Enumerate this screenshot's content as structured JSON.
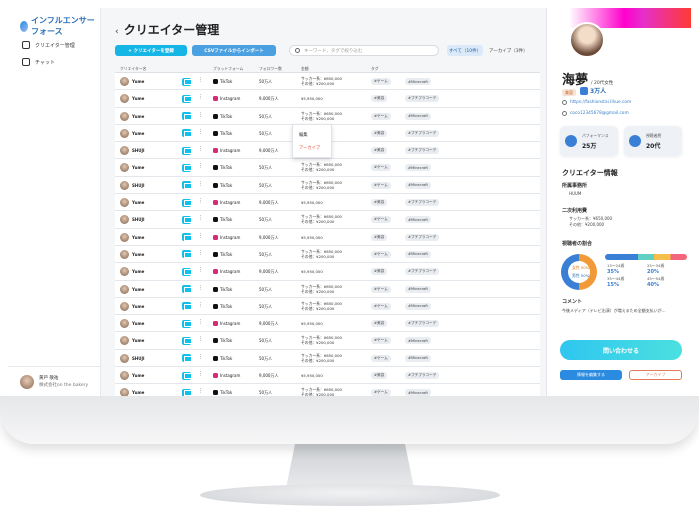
{
  "app": {
    "logo_text": "インフルエンサーフォース"
  },
  "sidebar": {
    "items": [
      {
        "label": "クリエイター管理",
        "icon": "gear-icon"
      },
      {
        "label": "チャット",
        "icon": "chat-icon"
      }
    ],
    "user": {
      "name": "黄戸 敬祐",
      "company": "株式会社on the bakery"
    }
  },
  "main": {
    "title": "クリエイター管理",
    "add_button": "+ クリエイターを登録",
    "csv_button": "CSVファイルからインポート",
    "search_placeholder": "キーワード、タグで絞り込む",
    "tab_all": "すべて（10件）",
    "tab_archive": "アーカイブ（3件）",
    "headers": [
      "クリエイター名",
      "プラットフォーム",
      "フォロワー数",
      "金額",
      "タグ"
    ],
    "rows": [
      {
        "name": "Yume",
        "platform": "TikTok",
        "followers": "50万人",
        "price": "サッカー系：¥650,000",
        "price2": "その他：¥200,000",
        "tag1": "#ゲーム",
        "tag2": "#Minecraft"
      },
      {
        "name": "Yume",
        "platform": "Instagram",
        "followers": "9,000万人",
        "price": "¥5,950,000",
        "price2": "",
        "tag1": "#美容",
        "tag2": "#プチプラコーデ"
      },
      {
        "name": "Yume",
        "platform": "TikTok",
        "followers": "50万人",
        "price": "サッカー系：¥650,000",
        "price2": "その他：¥200,000",
        "tag1": "#ゲーム",
        "tag2": "#Minecraft"
      },
      {
        "name": "Yume",
        "platform": "TikTok",
        "followers": "50万人",
        "price": "¥5,950,000",
        "price2": "",
        "tag1": "#美容",
        "tag2": "#プチプラコーデ"
      },
      {
        "name": "SHUJI",
        "platform": "Instagram",
        "followers": "9,000万人",
        "price": "¥5,950,000",
        "price2": "",
        "tag1": "#美容",
        "tag2": "#プチプラコーデ"
      },
      {
        "name": "Yume",
        "platform": "TikTok",
        "followers": "50万人",
        "price": "サッカー系：¥650,000",
        "price2": "その他：¥200,000",
        "tag1": "#ゲーム",
        "tag2": "#Minecraft"
      },
      {
        "name": "SHUJI",
        "platform": "TikTok",
        "followers": "50万人",
        "price": "サッカー系：¥650,000",
        "price2": "その他：¥200,000",
        "tag1": "#ゲーム",
        "tag2": "#Minecraft"
      },
      {
        "name": "Yume",
        "platform": "Instagram",
        "followers": "9,000万人",
        "price": "¥5,950,000",
        "price2": "",
        "tag1": "#美容",
        "tag2": "#プチプラコーデ"
      },
      {
        "name": "SHUJI",
        "platform": "TikTok",
        "followers": "50万人",
        "price": "サッカー系：¥650,000",
        "price2": "その他：¥200,000",
        "tag1": "#ゲーム",
        "tag2": "#Minecraft"
      },
      {
        "name": "Yume",
        "platform": "Instagram",
        "followers": "9,000万人",
        "price": "¥5,950,000",
        "price2": "",
        "tag1": "#美容",
        "tag2": "#プチプラコーデ"
      },
      {
        "name": "Yume",
        "platform": "TikTok",
        "followers": "50万人",
        "price": "サッカー系：¥650,000",
        "price2": "その他：¥200,000",
        "tag1": "#ゲーム",
        "tag2": "#Minecraft"
      },
      {
        "name": "Yume",
        "platform": "Instagram",
        "followers": "9,000万人",
        "price": "¥5,950,000",
        "price2": "",
        "tag1": "#美容",
        "tag2": "#プチプラコーデ"
      },
      {
        "name": "Yume",
        "platform": "TikTok",
        "followers": "50万人",
        "price": "サッカー系：¥650,000",
        "price2": "その他：¥200,000",
        "tag1": "#ゲーム",
        "tag2": "#Minecraft"
      },
      {
        "name": "Yume",
        "platform": "TikTok",
        "followers": "50万人",
        "price": "サッカー系：¥650,000",
        "price2": "その他：¥200,000",
        "tag1": "#ゲーム",
        "tag2": "#Minecraft"
      },
      {
        "name": "Yume",
        "platform": "Instagram",
        "followers": "9,000万人",
        "price": "¥5,950,000",
        "price2": "",
        "tag1": "#美容",
        "tag2": "#プチプラコーデ"
      },
      {
        "name": "Yume",
        "platform": "TikTok",
        "followers": "50万人",
        "price": "サッカー系：¥650,000",
        "price2": "その他：¥200,000",
        "tag1": "#ゲーム",
        "tag2": "#Minecraft"
      },
      {
        "name": "SHUJI",
        "platform": "TikTok",
        "followers": "50万人",
        "price": "サッカー系：¥650,000",
        "price2": "その他：¥200,000",
        "tag1": "#ゲーム",
        "tag2": "#Minecraft"
      },
      {
        "name": "Yume",
        "platform": "Instagram",
        "followers": "9,000万人",
        "price": "¥5,950,000",
        "price2": "",
        "tag1": "#美容",
        "tag2": "#プチプラコーデ"
      },
      {
        "name": "Yume",
        "platform": "TikTok",
        "followers": "50万人",
        "price": "サッカー系：¥650,000",
        "price2": "その他：¥200,000",
        "tag1": "#ゲーム",
        "tag2": "#Minecraft"
      }
    ],
    "menu": {
      "edit": "編集",
      "archive": "アーカイブ"
    }
  },
  "panel": {
    "name": "海夢",
    "age": "/ 20代女性",
    "badge": "美容",
    "followers": "3万人",
    "link1": "https://fashionstai.lihue.com",
    "link2": "coco12345678@gmail.com",
    "perf_label": "パフォーマンス",
    "perf_value": "25万",
    "gender_label": "視聴者層",
    "gender_value": "20代",
    "info_title": "クリエイター情報",
    "agency_label": "所属事務所",
    "agency_value": "HUUM",
    "fee_label": "二次利用費",
    "fee_value1": "サッカー系：¥650,000",
    "fee_value2": "その他：¥200,000",
    "audience_label": "視聴者の割合",
    "female": "女性 50%",
    "male": "男性 50%",
    "ages": [
      {
        "label": "13〜24歳",
        "value": "35%"
      },
      {
        "label": "25〜34歳",
        "value": "20%"
      },
      {
        "label": "35〜44歳",
        "value": "15%"
      },
      {
        "label": "45〜54歳",
        "value": "40%"
      }
    ],
    "comment_label": "コメント",
    "comment": "今後メディア（テレビ出演）が増えるため全額支払いが…",
    "contact": "問い合わせる",
    "edit": "情報を編集する",
    "archive": "アーカイブ"
  },
  "colors": {
    "accent": "#15b5e6",
    "tiktok": "#111111",
    "instagram": "#d62976"
  }
}
